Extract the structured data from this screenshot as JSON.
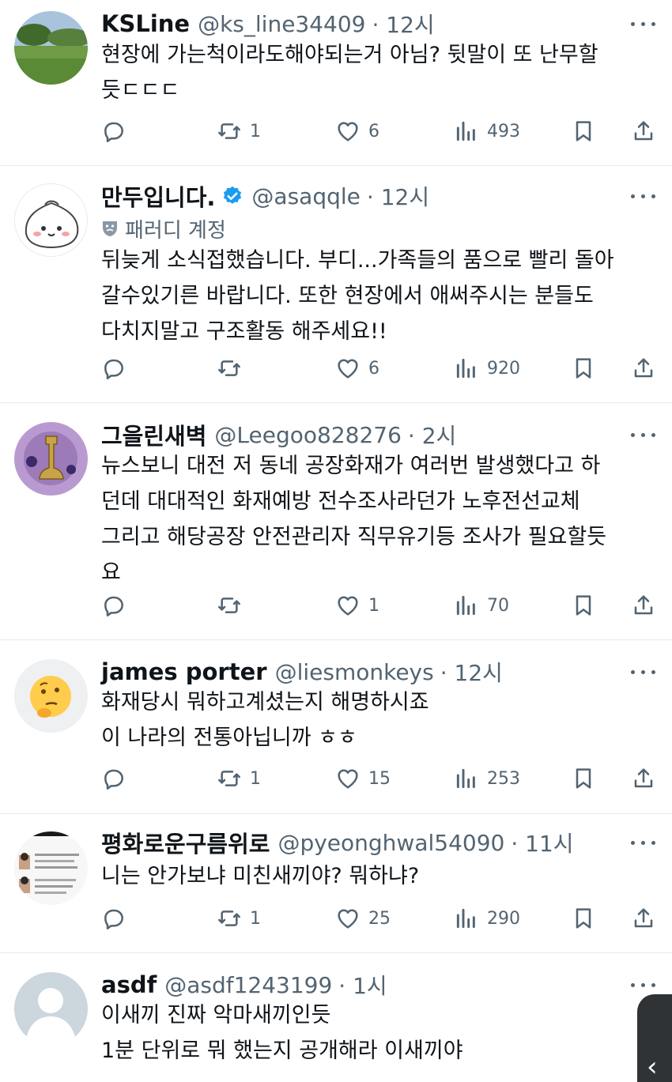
{
  "tweets": [
    {
      "name": "KSLine",
      "handle": "@ks_line34409",
      "time": "· 12시",
      "verified": false,
      "parody": false,
      "text": "현장에 가는척이라도해야되는거 아님? 뒷말이 또 난무할\n듯ㄷㄷㄷ",
      "retweets": "1",
      "likes": "6",
      "views": "493"
    },
    {
      "name": "만두입니다.",
      "handle": "@asaqqle",
      "time": "· 12시",
      "verified": true,
      "parody": true,
      "parody_label": "패러디 계정",
      "text": "뒤늦게 소식접했습니다. 부디...가족들의 품으로 빨리 돌아\n갈수있기른 바랍니다. 또한 현장에서 애써주시는 분들도\n다치지말고 구조활동 해주세요!!",
      "retweets": "",
      "likes": "6",
      "views": "920"
    },
    {
      "name": "그을린새벽",
      "handle": "@Leegoo828276",
      "time": "· 2시",
      "verified": false,
      "parody": false,
      "text": "뉴스보니 대전 저 동네 공장화재가 여러번 발생했다고 하\n던데 대대적인 화재예방 전수조사라던가 노후전선교체\n그리고 해당공장 안전관리자 직무유기등 조사가 필요할듯\n요",
      "retweets": "",
      "likes": "1",
      "views": "70"
    },
    {
      "name": "james porter",
      "handle": "@liesmonkeys",
      "time": "· 12시",
      "verified": false,
      "parody": false,
      "text": "화재당시 뭐하고계셨는지 해명하시죠\n이 나라의 전통아닙니까 ㅎㅎ",
      "retweets": "1",
      "likes": "15",
      "views": "253"
    },
    {
      "name": "평화로운구름위로",
      "handle": "@pyeonghwal54090",
      "time": "· 11시",
      "verified": false,
      "parody": false,
      "text": "니는 안가보냐 미친새끼야? 뭐하냐?",
      "retweets": "1",
      "likes": "25",
      "views": "290"
    },
    {
      "name": "asdf",
      "handle": "@asdf1243199",
      "time": "· 1시",
      "verified": false,
      "parody": false,
      "text": "이새끼 진짜 악마새끼인듯\n1분 단위로 뭐 했는지 공개해라 이새끼야"
    }
  ],
  "icons": {
    "reply": "reply-icon",
    "retweet": "retweet-icon",
    "like": "heart-icon",
    "views": "views-icon",
    "bookmark": "bookmark-icon",
    "share": "share-icon",
    "more": "more-icon",
    "verified": "verified-badge-icon",
    "parody": "parody-mask-icon"
  },
  "colors": {
    "text": "#0f1419",
    "secondary": "#536471",
    "verified": "#1d9bf0",
    "divider": "#e7e9ea"
  },
  "side_handle": {
    "glyph": "‹"
  }
}
